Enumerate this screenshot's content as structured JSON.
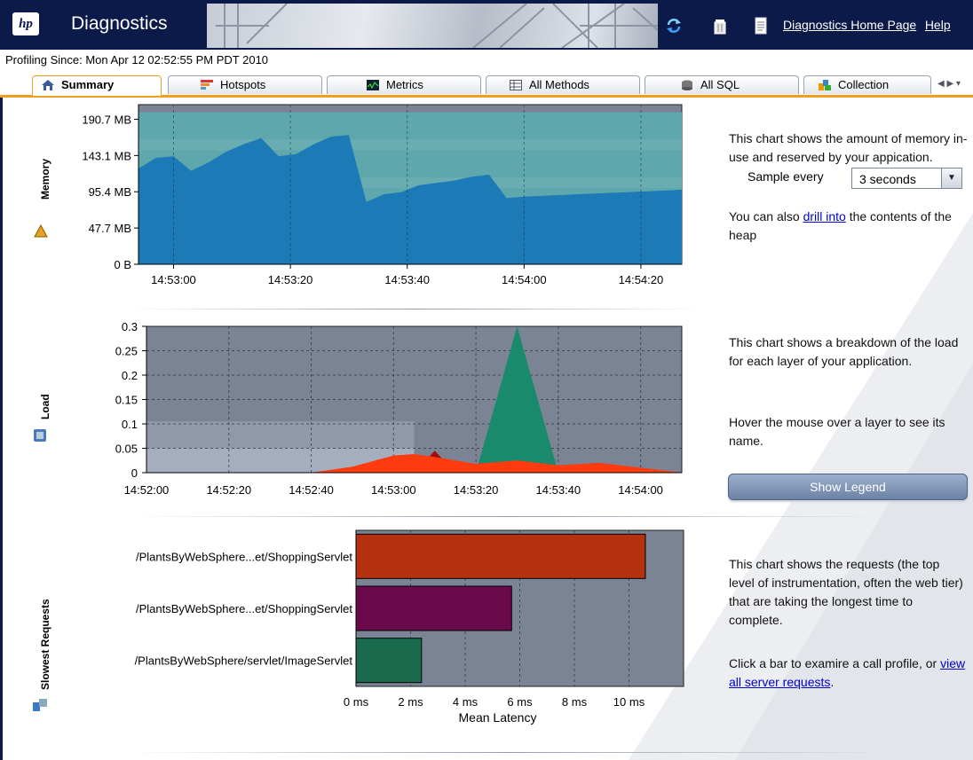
{
  "header": {
    "title": "Diagnostics",
    "logo": "hp",
    "links": [
      "Diagnostics Home Page",
      "Help"
    ],
    "icons": [
      "refresh-icon",
      "trash-icon",
      "document-icon"
    ]
  },
  "profiling_since": "Profiling Since: Mon Apr 12 02:52:55 PM PDT 2010",
  "tabs": [
    {
      "label": "Summary",
      "icon": "home-icon",
      "active": true
    },
    {
      "label": "Hotspots",
      "icon": "hotspots-icon"
    },
    {
      "label": "Metrics",
      "icon": "metrics-icon"
    },
    {
      "label": "All Methods",
      "icon": "table-icon"
    },
    {
      "label": "All SQL",
      "icon": "database-icon"
    },
    {
      "label": "Collection",
      "icon": "collection-icon"
    }
  ],
  "memory": {
    "section_label": "Memory",
    "description": "This chart shows the amount of memory in-use and reserved by your appication.",
    "drill_prefix": "You can also ",
    "drill_link": "drill into",
    "drill_suffix": " the contents of the heap",
    "sample_label": "Sample every",
    "sample_value": "3 seconds"
  },
  "load": {
    "section_label": "Load",
    "description": "This chart shows a breakdown of the load for each layer of your application.",
    "hover_text": "Hover the mouse over a layer to see its name.",
    "legend_button": "Show Legend"
  },
  "requests": {
    "section_label": "Slowest  Requests",
    "description": "This chart shows the requests (the top level of instrumentation, often the web tier) that are taking the longest time to complete.",
    "click_text": "Click a bar to examire a call profile, or ",
    "link": "view all server requests",
    "link_suffix": "."
  },
  "colors": {
    "header_bg": "#0c1a4a",
    "tab_accent": "#f0a020",
    "chart_bg": "#7a8494",
    "memory_reserved": "#5ea7ad",
    "memory_used": "#1c7ab7",
    "load_green": "#1a8a6c",
    "load_red": "#ff3b0f",
    "load_darkred": "#9a1010",
    "bar1": "#b5310f",
    "bar2": "#6a0a4a",
    "bar3": "#1a6a4e"
  },
  "chart_data": [
    {
      "type": "area",
      "title": "",
      "ylabel": "",
      "y_ticks": [
        "0 B",
        "47.7 MB",
        "95.4 MB",
        "143.1 MB",
        "190.7 MB"
      ],
      "x_ticks": [
        "14:53:00",
        "14:53:20",
        "14:53:40",
        "14:54:00",
        "14:54:20"
      ],
      "x_unit": "seconds",
      "x": [
        "14:52:54",
        "14:52:57",
        "14:53:00",
        "14:53:03",
        "14:53:06",
        "14:53:09",
        "14:53:12",
        "14:53:15",
        "14:53:18",
        "14:53:21",
        "14:53:24",
        "14:53:27",
        "14:53:30",
        "14:53:33",
        "14:53:36",
        "14:53:39",
        "14:53:42",
        "14:53:45",
        "14:53:48",
        "14:53:51",
        "14:53:54",
        "14:53:57",
        "14:54:00",
        "14:54:03",
        "14:54:06",
        "14:54:09",
        "14:54:12",
        "14:54:15",
        "14:54:18",
        "14:54:21",
        "14:54:24",
        "14:54:27"
      ],
      "series": [
        {
          "values_mb": [
            126,
            140,
            142,
            123,
            134,
            148,
            158,
            166,
            142,
            145,
            158,
            168,
            170,
            82,
            92,
            95,
            104,
            107,
            110,
            115,
            118,
            87,
            89,
            90,
            91,
            92,
            93,
            94,
            95,
            96,
            97,
            98
          ]
        },
        {
          "values_mb": [
            200,
            200,
            200,
            200,
            200,
            200,
            200,
            200,
            200,
            200,
            200,
            200,
            200,
            200,
            200,
            200,
            200,
            200,
            200,
            200,
            200,
            200,
            200,
            200,
            200,
            200,
            200,
            200,
            200,
            200,
            200,
            200
          ]
        }
      ],
      "ylim_mb": [
        0,
        210
      ],
      "grid": true
    },
    {
      "type": "area",
      "y_ticks": [
        "0",
        "0.05",
        "0.1",
        "0.15",
        "0.2",
        "0.25",
        "0.3"
      ],
      "x_ticks": [
        "14:52:00",
        "14:52:20",
        "14:52:40",
        "14:53:00",
        "14:53:20",
        "14:53:40",
        "14:54:00"
      ],
      "ylim": [
        0,
        0.3
      ],
      "grid": true,
      "series": [
        {
          "x": [
            "14:52:40",
            "14:52:50",
            "14:53:00",
            "14:53:05",
            "14:53:10",
            "14:53:20",
            "14:53:30",
            "14:53:40",
            "14:53:50",
            "14:54:00",
            "14:54:10"
          ],
          "values": [
            0.0,
            0.012,
            0.035,
            0.038,
            0.032,
            0.018,
            0.025,
            0.015,
            0.02,
            0.01,
            0.0
          ]
        },
        {
          "x": [
            "14:53:05",
            "14:53:10",
            "14:53:15"
          ],
          "values": [
            0.0,
            0.045,
            0.0
          ]
        },
        {
          "x": [
            "14:53:20",
            "14:53:30",
            "14:53:40"
          ],
          "values": [
            0.0,
            0.3,
            0.0
          ]
        }
      ]
    },
    {
      "type": "bar",
      "orientation": "horizontal",
      "xlabel": "Mean Latency",
      "x_ticks": [
        "0 ms",
        "2 ms",
        "4 ms",
        "6 ms",
        "8 ms",
        "10 ms"
      ],
      "xlim_ms": [
        0,
        12
      ],
      "categories": [
        "/PlantsByWebSphere...et/ShoppingServlet",
        "/PlantsByWebSphere...et/ShoppingServlet",
        "/PlantsByWebSphere/servlet/ImageServlet"
      ],
      "values": [
        10.6,
        5.7,
        2.4
      ],
      "grid": true
    }
  ]
}
